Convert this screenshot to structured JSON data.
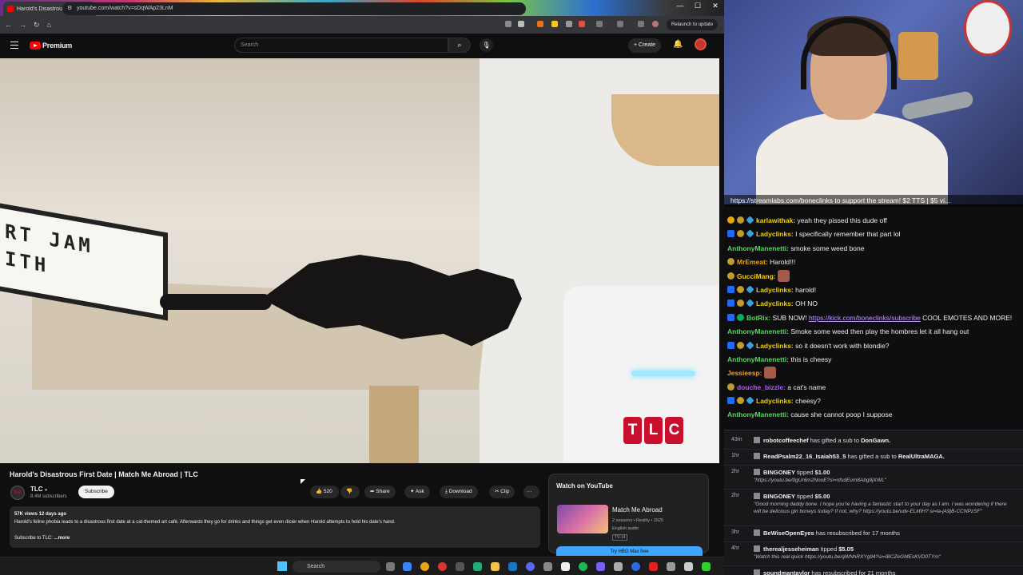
{
  "browser": {
    "tab_title": "Harold's Disastrous First D",
    "url": "youtube.com/watch?v=sDqWAp23LnM",
    "relaunch_label": "Relaunch to update"
  },
  "youtube": {
    "brand": "Premium",
    "search_placeholder": "Search",
    "create_label": "+ Create"
  },
  "video": {
    "title": "Harold's Disastrous First Date | Match Me Abroad | TLC",
    "sign_line1": "RT JAM",
    "sign_line2": "ITH",
    "watermark": [
      "T",
      "L",
      "C"
    ],
    "channel_name": "TLC",
    "channel_avatar_text": "TLC",
    "subscribers": "8.4M subscribers",
    "subscribe_label": "Subscribe",
    "likes": "520",
    "share_label": "Share",
    "ask_label": "Ask",
    "download_label": "Download",
    "clip_label": "Clip",
    "more_label": "···",
    "views_date": "57K views  12 days ago",
    "description": "Harold's feline phobia leads to a disastrous first date at a cat-themed art café. Afterwards they go for drinks and things get even dicier when Harold attempts to hold his date's hand.",
    "subscribe_to": "Subscribe to TLC:",
    "more_link": "...more"
  },
  "watch_box": {
    "heading": "Watch on YouTube",
    "show_title": "Match Me Abroad",
    "show_meta": "2 seasons • Reality • 2025",
    "show_lang": "English audio",
    "rating": "TV-14",
    "cta": "Try HBO Max free"
  },
  "taskbar": {
    "search_label": "Search"
  },
  "stream": {
    "ticker": "https://streamlabs.com/boneclinks to support the stream! $2 TTS | $5 vi..."
  },
  "chat": [
    {
      "badges": [
        "b-num",
        "b-hat",
        "b-cube"
      ],
      "name": "karlawithak",
      "color": "#f0d000",
      "text": " yeah they pissed this dude off"
    },
    {
      "badges": [
        "b-sword",
        "b-hat",
        "b-cube"
      ],
      "name": "Ladyclinks",
      "color": "#f0d000",
      "text": " I specifically remember that part lol"
    },
    {
      "badges": [],
      "name": "AnthonyManenetti",
      "color": "#5ad65a",
      "text": " smoke some weed bone"
    },
    {
      "badges": [
        "b-hat"
      ],
      "name": "MrEmeat",
      "color": "#e5a800",
      "text": " Harold!!!"
    },
    {
      "badges": [
        "b-hat"
      ],
      "name": "GucciMang",
      "color": "#ffd000",
      "text": " ",
      "emote": true
    },
    {
      "badges": [
        "b-sword",
        "b-hat",
        "b-cube"
      ],
      "name": "Ladyclinks",
      "color": "#f0d000",
      "text": " harold!"
    },
    {
      "badges": [
        "b-sword",
        "b-hat",
        "b-cube"
      ],
      "name": "Ladyclinks",
      "color": "#f0d000",
      "text": " OH NO"
    },
    {
      "badges": [
        "b-sword",
        "b-check"
      ],
      "name": "BotRix",
      "color": "#5ad65a",
      "text": " SUB NOW! ",
      "link": "https://kick.com/boneclinks/subscribe",
      "after": " COOL EMOTES AND MORE!"
    },
    {
      "badges": [],
      "name": "AnthonyManenetti",
      "color": "#5ad65a",
      "text": " Smoke some weed then play the hombres let it all hang out"
    },
    {
      "badges": [
        "b-sword",
        "b-hat",
        "b-cube"
      ],
      "name": "Ladyclinks",
      "color": "#f0d000",
      "text": " so it doesn't work with blondie?"
    },
    {
      "badges": [],
      "name": "AnthonyManenetti",
      "color": "#5ad65a",
      "text": " this is cheesy"
    },
    {
      "badges": [],
      "name": "Jessieesp",
      "color": "#ff9a1a",
      "text": " ",
      "emote": true
    },
    {
      "badges": [
        "b-hat"
      ],
      "name": "douche_bizzle",
      "color": "#b05cff",
      "text": " a cat's name"
    },
    {
      "badges": [
        "b-sword",
        "b-hat",
        "b-cube"
      ],
      "name": "Ladyclinks",
      "color": "#f0d000",
      "text": " cheesy?"
    },
    {
      "badges": [],
      "name": "AnthonyManenetti",
      "color": "#5ad65a",
      "text": " cause she cannot poop I suppose"
    }
  ],
  "events": [
    {
      "time": "43m",
      "user": "robotcoffeechef",
      "action": " has gifted a sub to ",
      "target": "DonGawn."
    },
    {
      "time": "1hr",
      "user": "ReadPsalm22_16_Isaiah53_5",
      "action": " has gifted a sub to ",
      "target": "RealUltraMAGA."
    },
    {
      "time": "2hr",
      "user": "BINGONEY",
      "action": " tipped ",
      "target": "$1.00",
      "note": "\"https://youtu.be/0gUr6m2NooE?si=nfsdEum8Abg9jXWL\""
    },
    {
      "time": "2hr",
      "user": "BINGONEY",
      "action": " tipped ",
      "target": "$5.00",
      "note": "\"Good morning daddy bone. I hope you're having a fantastic start to your day as I am. I was wondering if there will be delicious gin boneys today? If not, why? https://youtu.be/udv-ELkfIH? si=la-jA9jB-CCNPzSF\""
    },
    {
      "time": "3hr",
      "user": "BeWiseOpenEyes",
      "action": " has resubscribed for 17 months",
      "target": ""
    },
    {
      "time": "4hr",
      "user": "therealjesseheiman",
      "action": " tipped ",
      "target": "$5.05",
      "note": "\"Watch this real quick https://youtu.be/qWNhRXYg94?si=IBCZeGMEsKVD0TYm\""
    },
    {
      "time": "",
      "user": "soundmantaylor",
      "action": " has resubscribed for 21 months",
      "target": ""
    }
  ]
}
